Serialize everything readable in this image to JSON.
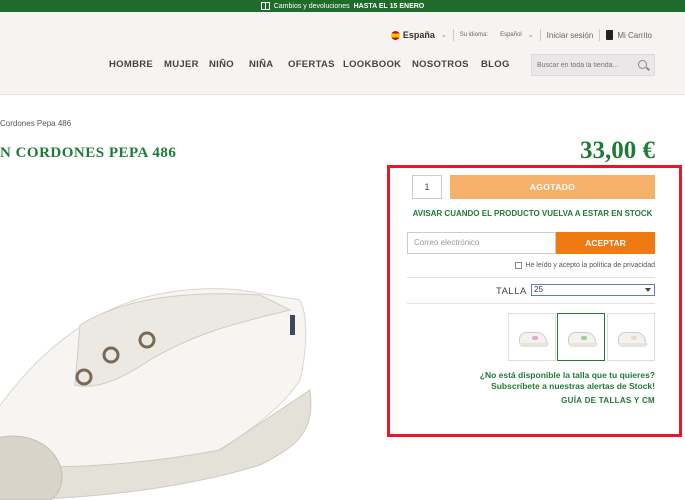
{
  "promo": {
    "text": "Cambios y devoluciones",
    "highlight": "HASTA EL 15 ENERO"
  },
  "utility": {
    "country": "España",
    "language_label": "Su idioma:",
    "language": "Español",
    "login": "Iniciar sesión",
    "cart": "Mi Carrito"
  },
  "nav": [
    "HOMBRE",
    "MUJER",
    "NIÑO",
    "NIÑA",
    "OFERTAS",
    "LOOKBOOK",
    "NOSOTROS",
    "BLOG"
  ],
  "search": {
    "placeholder": "Buscar en toda la tienda..."
  },
  "breadcrumb": "Cordones Pepa 486",
  "product": {
    "title": "N CORDONES PEPA 486",
    "price": "33,00 €"
  },
  "purchase": {
    "quantity": "1",
    "sold_out_label": "AGOTADO",
    "notify_text": "AVISAR CUANDO EL PRODUCTO VUELVA A ESTAR EN STOCK",
    "email_placeholder": "Correo electrónico",
    "accept_label": "ACEPTAR",
    "privacy_text": "He leído y acepto la política de privacidad",
    "size_label": "TALLA",
    "size_value": "25",
    "stock_question": "¿No está disponible la talla que tu quieres?",
    "stock_subscribe": "Subscríbete a nuestras alertas de Stock!",
    "size_guide": "GUÍA DE TALLAS Y CM"
  },
  "colors": {
    "brand_green": "#1f7a35",
    "accept_orange": "#ef7a12",
    "sold_out": "#f5b069",
    "highlight_red": "#e3192b"
  }
}
